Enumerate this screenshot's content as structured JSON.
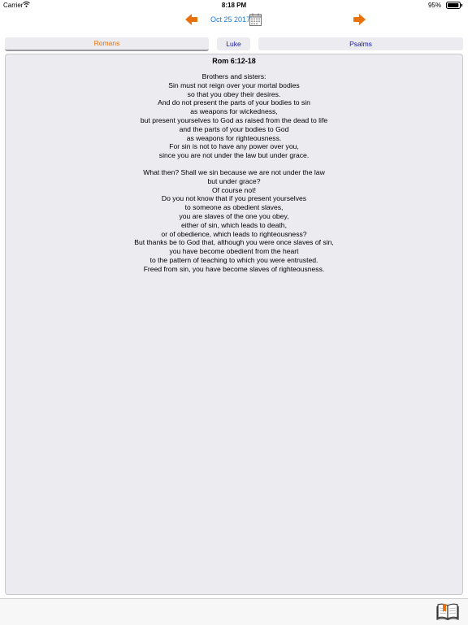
{
  "status_bar": {
    "carrier": "Carrier",
    "time": "8:18 PM",
    "battery": "95%",
    "battery_level": 0.95
  },
  "date_nav": {
    "prev_icon": "left-arrow-icon",
    "next_icon": "right-arrow-icon",
    "date": "Oct 25 2017",
    "calendar_icon": "calendar-icon",
    "arrow_color": "#e8720c"
  },
  "tabs": [
    {
      "label": "Romans",
      "selected": true
    },
    {
      "label": "Luke",
      "selected": false
    },
    {
      "label": "Psalms",
      "selected": false
    }
  ],
  "reading": {
    "reference": "Rom 6:12-18",
    "stanzas": [
      [
        "Brothers and sisters:",
        "Sin must not reign over your mortal bodies",
        "so that you obey their desires.",
        "And do not present the parts of your bodies to sin",
        "as weapons for wickedness,",
        "but present yourselves to God as raised from the dead to life",
        "and the parts of your bodies to God",
        "as weapons for righteousness.",
        "For sin is not to have any power over you,",
        "since you are not under the law but under grace."
      ],
      [
        "What then? Shall we sin because we are not under the law",
        "but under grace?",
        "Of course not!",
        "Do you not know that if you present yourselves",
        "to someone as obedient slaves,",
        "you are slaves of the one you obey,",
        "either of sin, which leads to death,",
        "or of obedience, which leads to righteousness?",
        "But thanks be to God that, although you were once slaves of sin,",
        "you have become obedient from the heart",
        "to the pattern of teaching to which you were entrusted.",
        "Freed from sin, you have become slaves of righteousness."
      ]
    ]
  },
  "bottom_bar": {
    "icon": "book-icon"
  }
}
